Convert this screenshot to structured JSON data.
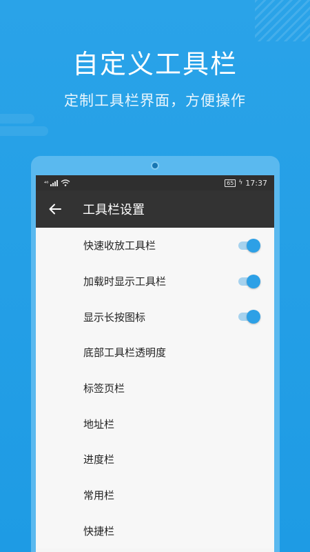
{
  "promo": {
    "headline": "自定义工具栏",
    "subtitle": "定制工具栏界面，方便操作"
  },
  "status_bar": {
    "signal": "⁴⁶",
    "battery": "65",
    "time": "17:37"
  },
  "app_bar": {
    "back_icon": "arrow-left-icon",
    "title": "工具栏设置"
  },
  "settings": [
    {
      "label": "快速收放工具栏",
      "toggle": true
    },
    {
      "label": "加载时显示工具栏",
      "toggle": true
    },
    {
      "label": "显示长按图标",
      "toggle": true
    },
    {
      "label": "底部工具栏透明度"
    },
    {
      "label": "标签页栏"
    },
    {
      "label": "地址栏"
    },
    {
      "label": "进度栏"
    },
    {
      "label": "常用栏"
    },
    {
      "label": "快捷栏"
    }
  ],
  "colors": {
    "background": "#2aa3e8",
    "accent": "#2da0e6",
    "appbar": "#333333"
  }
}
